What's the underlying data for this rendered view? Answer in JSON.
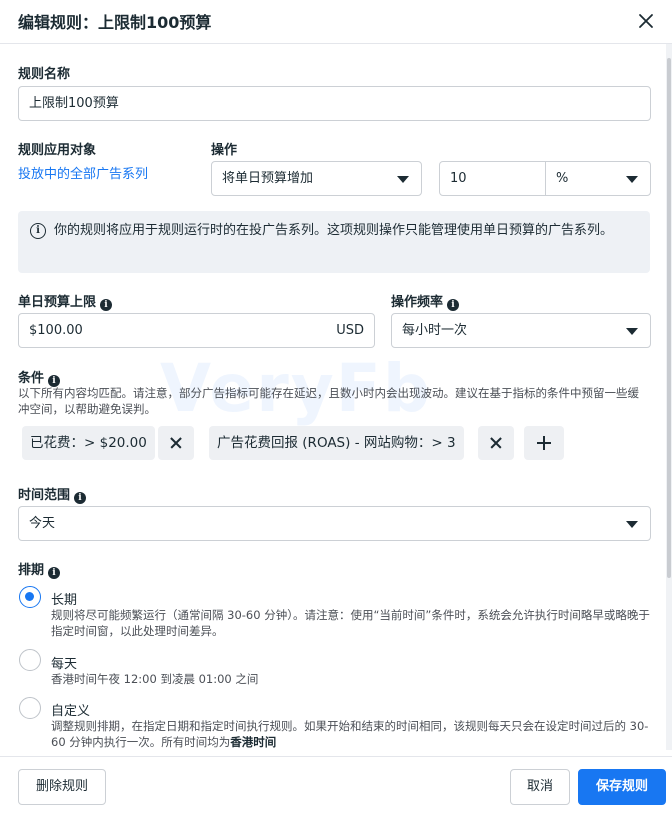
{
  "header": {
    "title": "编辑规则：上限制100预算",
    "close_icon": "close-icon"
  },
  "rule_name": {
    "label": "规则名称",
    "value": "上限制100预算"
  },
  "apply_to": {
    "label": "规则应用对象",
    "link": "投放中的全部广告系列"
  },
  "action": {
    "label": "操作",
    "selected": "将单日预算增加",
    "amount": "10",
    "unit": "%"
  },
  "notice": {
    "text": "你的规则将应用于规则运行时的在投广告系列。这项规则操作只能管理使用单日预算的广告系列。"
  },
  "daily_budget_cap": {
    "label": "单日预算上限",
    "value": "$100.00",
    "currency": "USD"
  },
  "frequency": {
    "label": "操作频率",
    "selected": "每小时一次"
  },
  "conditions": {
    "label": "条件",
    "description": "以下所有内容均匹配。请注意，部分广告指标可能存在延迟，且数小时内会出现波动。建议在基于指标的条件中预留一些缓冲空间，以帮助避免误判。",
    "items": [
      {
        "text": "已花费：> $20.00"
      },
      {
        "text": "广告花费回报 (ROAS) - 网站购物：> 3"
      }
    ]
  },
  "time_range": {
    "label": "时间范围",
    "selected": "今天"
  },
  "schedule": {
    "label": "排期",
    "options": [
      {
        "title": "长期",
        "desc": "规则将尽可能频繁运行（通常间隔 30-60 分钟）。请注意：使用“当前时间”条件时，系统会允许执行时间略早或略晚于指定时间窗，以此处理时间差异。",
        "checked": true
      },
      {
        "title": "每天",
        "desc": "香港时间午夜 12:00 到凌晨 01:00 之间",
        "checked": false
      },
      {
        "title": "自定义",
        "desc": "调整规则排期，在指定日期和指定时间执行规则。如果开始和结束的时间相同，该规则每天只会在设定时间过后的 30-60 分钟内执行一次。所有时间均为",
        "desc_bold": "香港时间",
        "checked": false
      }
    ]
  },
  "footer": {
    "delete": "删除规则",
    "cancel": "取消",
    "save": "保存规则"
  },
  "watermark": "VeryFb",
  "colors": {
    "accent": "#1877f2",
    "text": "#1c2b33"
  }
}
